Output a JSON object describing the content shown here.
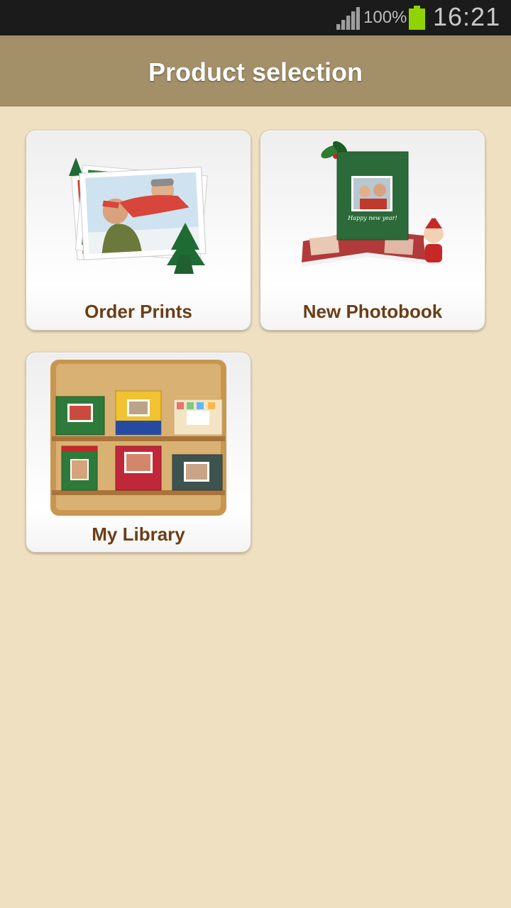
{
  "status_bar": {
    "battery_percent": "100%",
    "time": "16:21",
    "signal_icon": "signal-bars-icon",
    "battery_icon": "battery-full-icon",
    "battery_color": "#8fd400"
  },
  "header": {
    "title": "Product selection",
    "background": "#a39068"
  },
  "products": {
    "order_prints": {
      "label": "Order Prints",
      "icon": "stacked-photos-christmas-icon"
    },
    "new_photobook": {
      "label": "New Photobook",
      "icon": "christmas-photobook-icon"
    },
    "my_library": {
      "label": "My Library",
      "icon": "bookshelf-icon"
    }
  },
  "colors": {
    "background": "#eee0c1",
    "label_text": "#6b3e16"
  }
}
